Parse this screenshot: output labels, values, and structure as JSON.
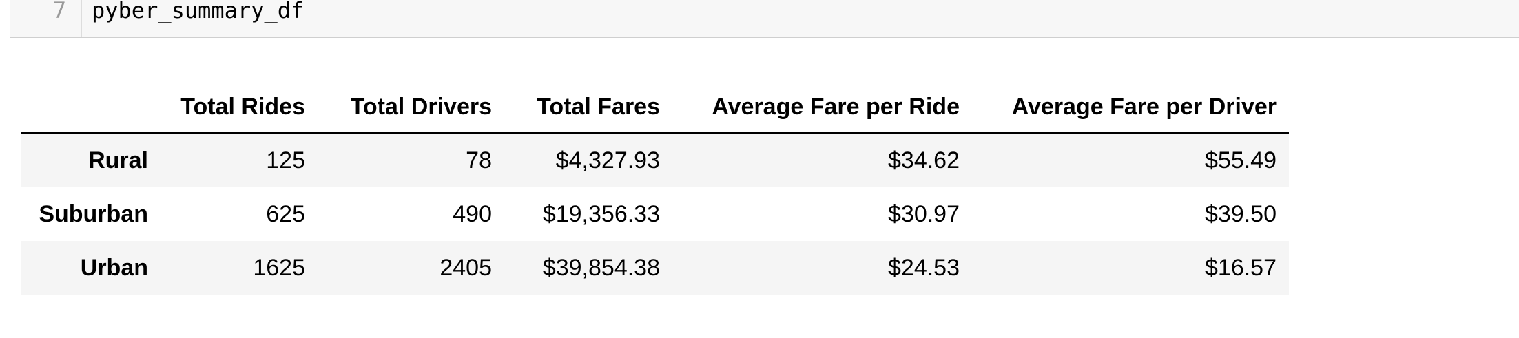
{
  "code_cell": {
    "line_number": "7",
    "code": "pyber_summary_df"
  },
  "table": {
    "columns": [
      "",
      "Total Rides",
      "Total Drivers",
      "Total Fares",
      "Average Fare per Ride",
      "Average Fare per Driver"
    ],
    "rows": [
      {
        "index": "Rural",
        "values": [
          "125",
          "78",
          "$4,327.93",
          "$34.62",
          "$55.49"
        ]
      },
      {
        "index": "Suburban",
        "values": [
          "625",
          "490",
          "$19,356.33",
          "$30.97",
          "$39.50"
        ]
      },
      {
        "index": "Urban",
        "values": [
          "1625",
          "2405",
          "$39,854.38",
          "$24.53",
          "$16.57"
        ]
      }
    ]
  }
}
